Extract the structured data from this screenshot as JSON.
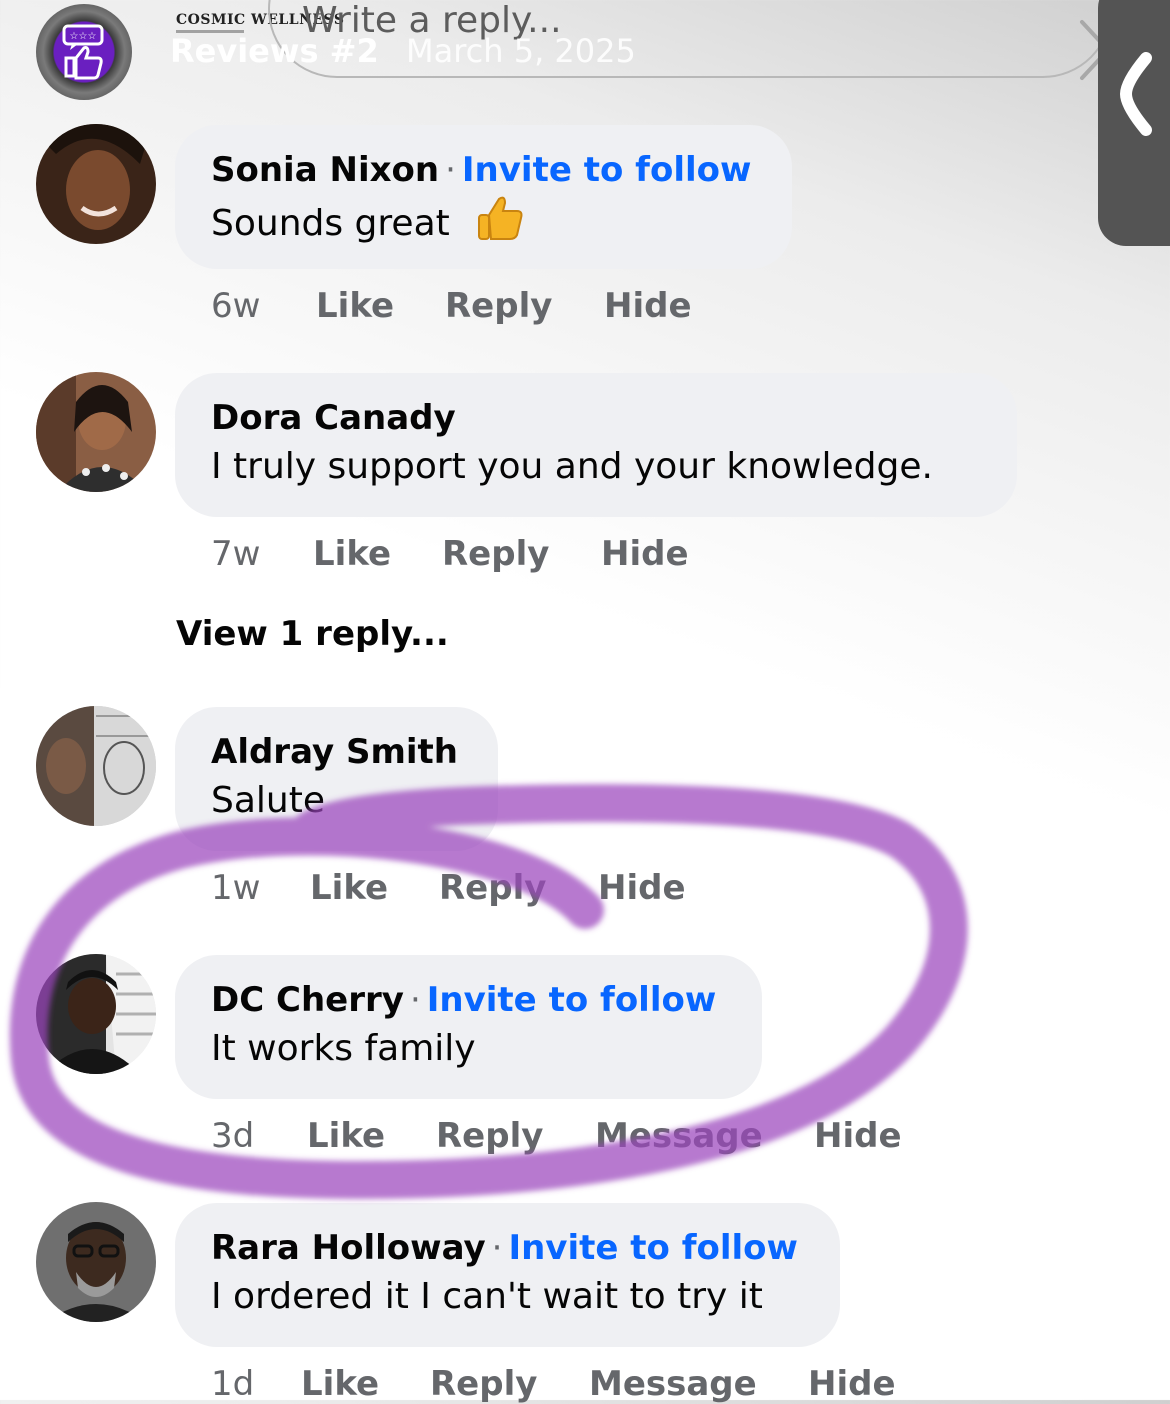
{
  "header": {
    "brand_logo_text": "COSMIC WELLNESS",
    "reply_placeholder": "Write a reply...",
    "story_title": "Reviews #2",
    "story_date": "March 5, 2025"
  },
  "comments": [
    {
      "name": "Sonia Nixon",
      "invite": "Invite to follow",
      "text": "Sounds great",
      "time": "6w",
      "actions": [
        "Like",
        "Reply",
        "Hide"
      ]
    },
    {
      "name": "Dora Canady",
      "text": "I truly support you and your knowledge.",
      "time": "7w",
      "actions": [
        "Like",
        "Reply",
        "Hide"
      ],
      "view_replies": "View 1 reply..."
    },
    {
      "name": "Aldray Smith",
      "text": "Salute",
      "time": "1w",
      "actions": [
        "Like",
        "Reply",
        "Hide"
      ]
    },
    {
      "name": "DC Cherry",
      "invite": "Invite to follow",
      "text": "It works family",
      "time": "3d",
      "actions": [
        "Like",
        "Reply",
        "Message",
        "Hide"
      ]
    },
    {
      "name": "Rara Holloway",
      "invite": "Invite to follow",
      "text": "I ordered it I can't wait to try it",
      "time": "1d",
      "actions": [
        "Like",
        "Reply",
        "Message",
        "Hide"
      ]
    }
  ],
  "colors": {
    "link_blue": "#0866ff",
    "secondary_text": "#65676b",
    "bubble_bg": "#eff0f3",
    "highlight_purple": "#a04fc0"
  },
  "icons": [
    "review-badge-icon",
    "send-chevron-icon",
    "back-chevron-icon",
    "thumbs-up-emoji"
  ]
}
